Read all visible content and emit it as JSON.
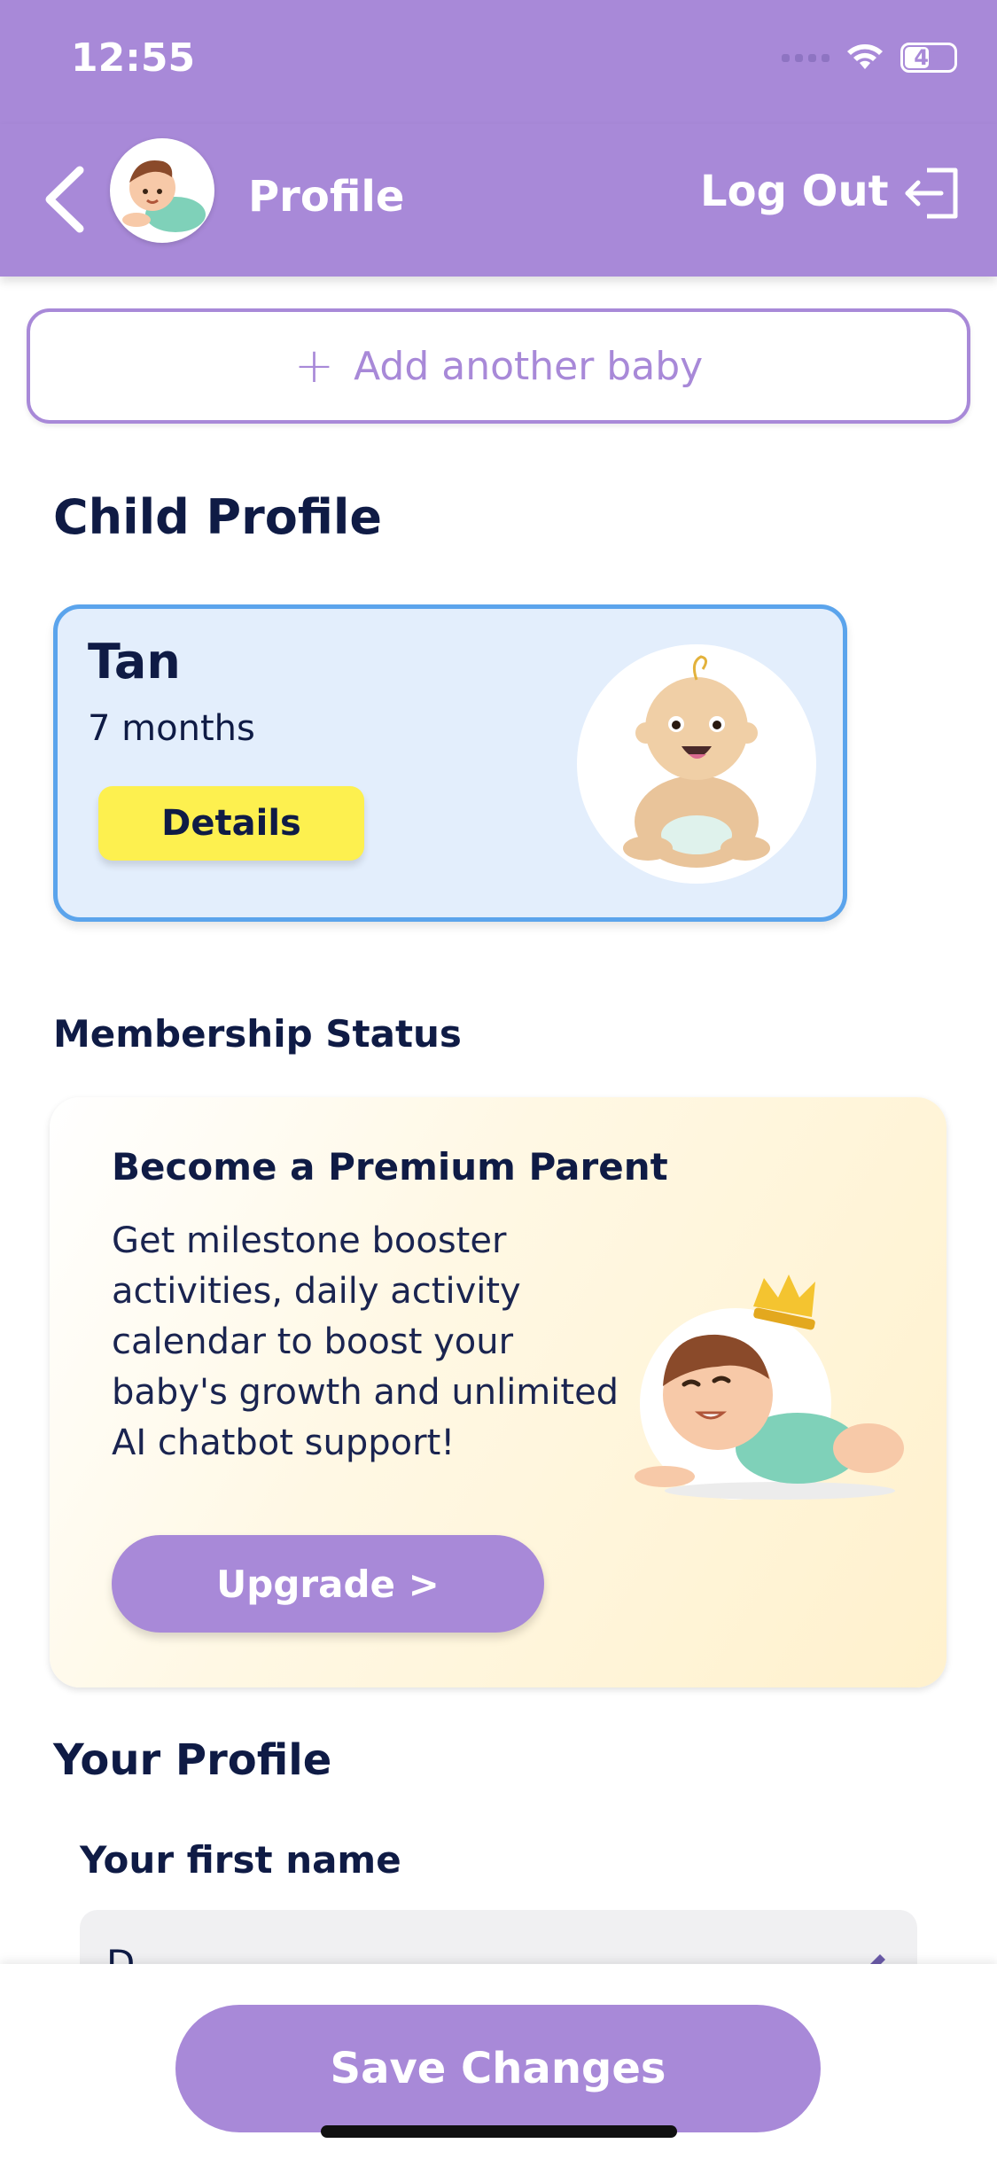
{
  "status_bar": {
    "time": "12:55",
    "battery": "47"
  },
  "header": {
    "title": "Profile",
    "logout_label": "Log Out"
  },
  "add_baby": {
    "plus": "+",
    "label": "Add another baby"
  },
  "child_profile": {
    "section_title": "Child Profile",
    "child": {
      "name": "Tan",
      "age": "7 months",
      "details_label": "Details"
    }
  },
  "membership": {
    "label": "Membership Status",
    "card": {
      "title": "Become a Premium Parent",
      "description": "Get milestone booster activities, daily activity calendar to boost your baby's growth and unlimited AI chatbot support!",
      "upgrade_label": "Upgrade >"
    }
  },
  "your_profile": {
    "title": "Your Profile",
    "first_name_label": "Your first name",
    "first_name_value": "D"
  },
  "footer": {
    "save_label": "Save Changes"
  },
  "colors": {
    "accent": "#a889d8",
    "card_border": "#5ba4ec",
    "details_button": "#fdf04f",
    "text_dark": "#0f1b45"
  }
}
